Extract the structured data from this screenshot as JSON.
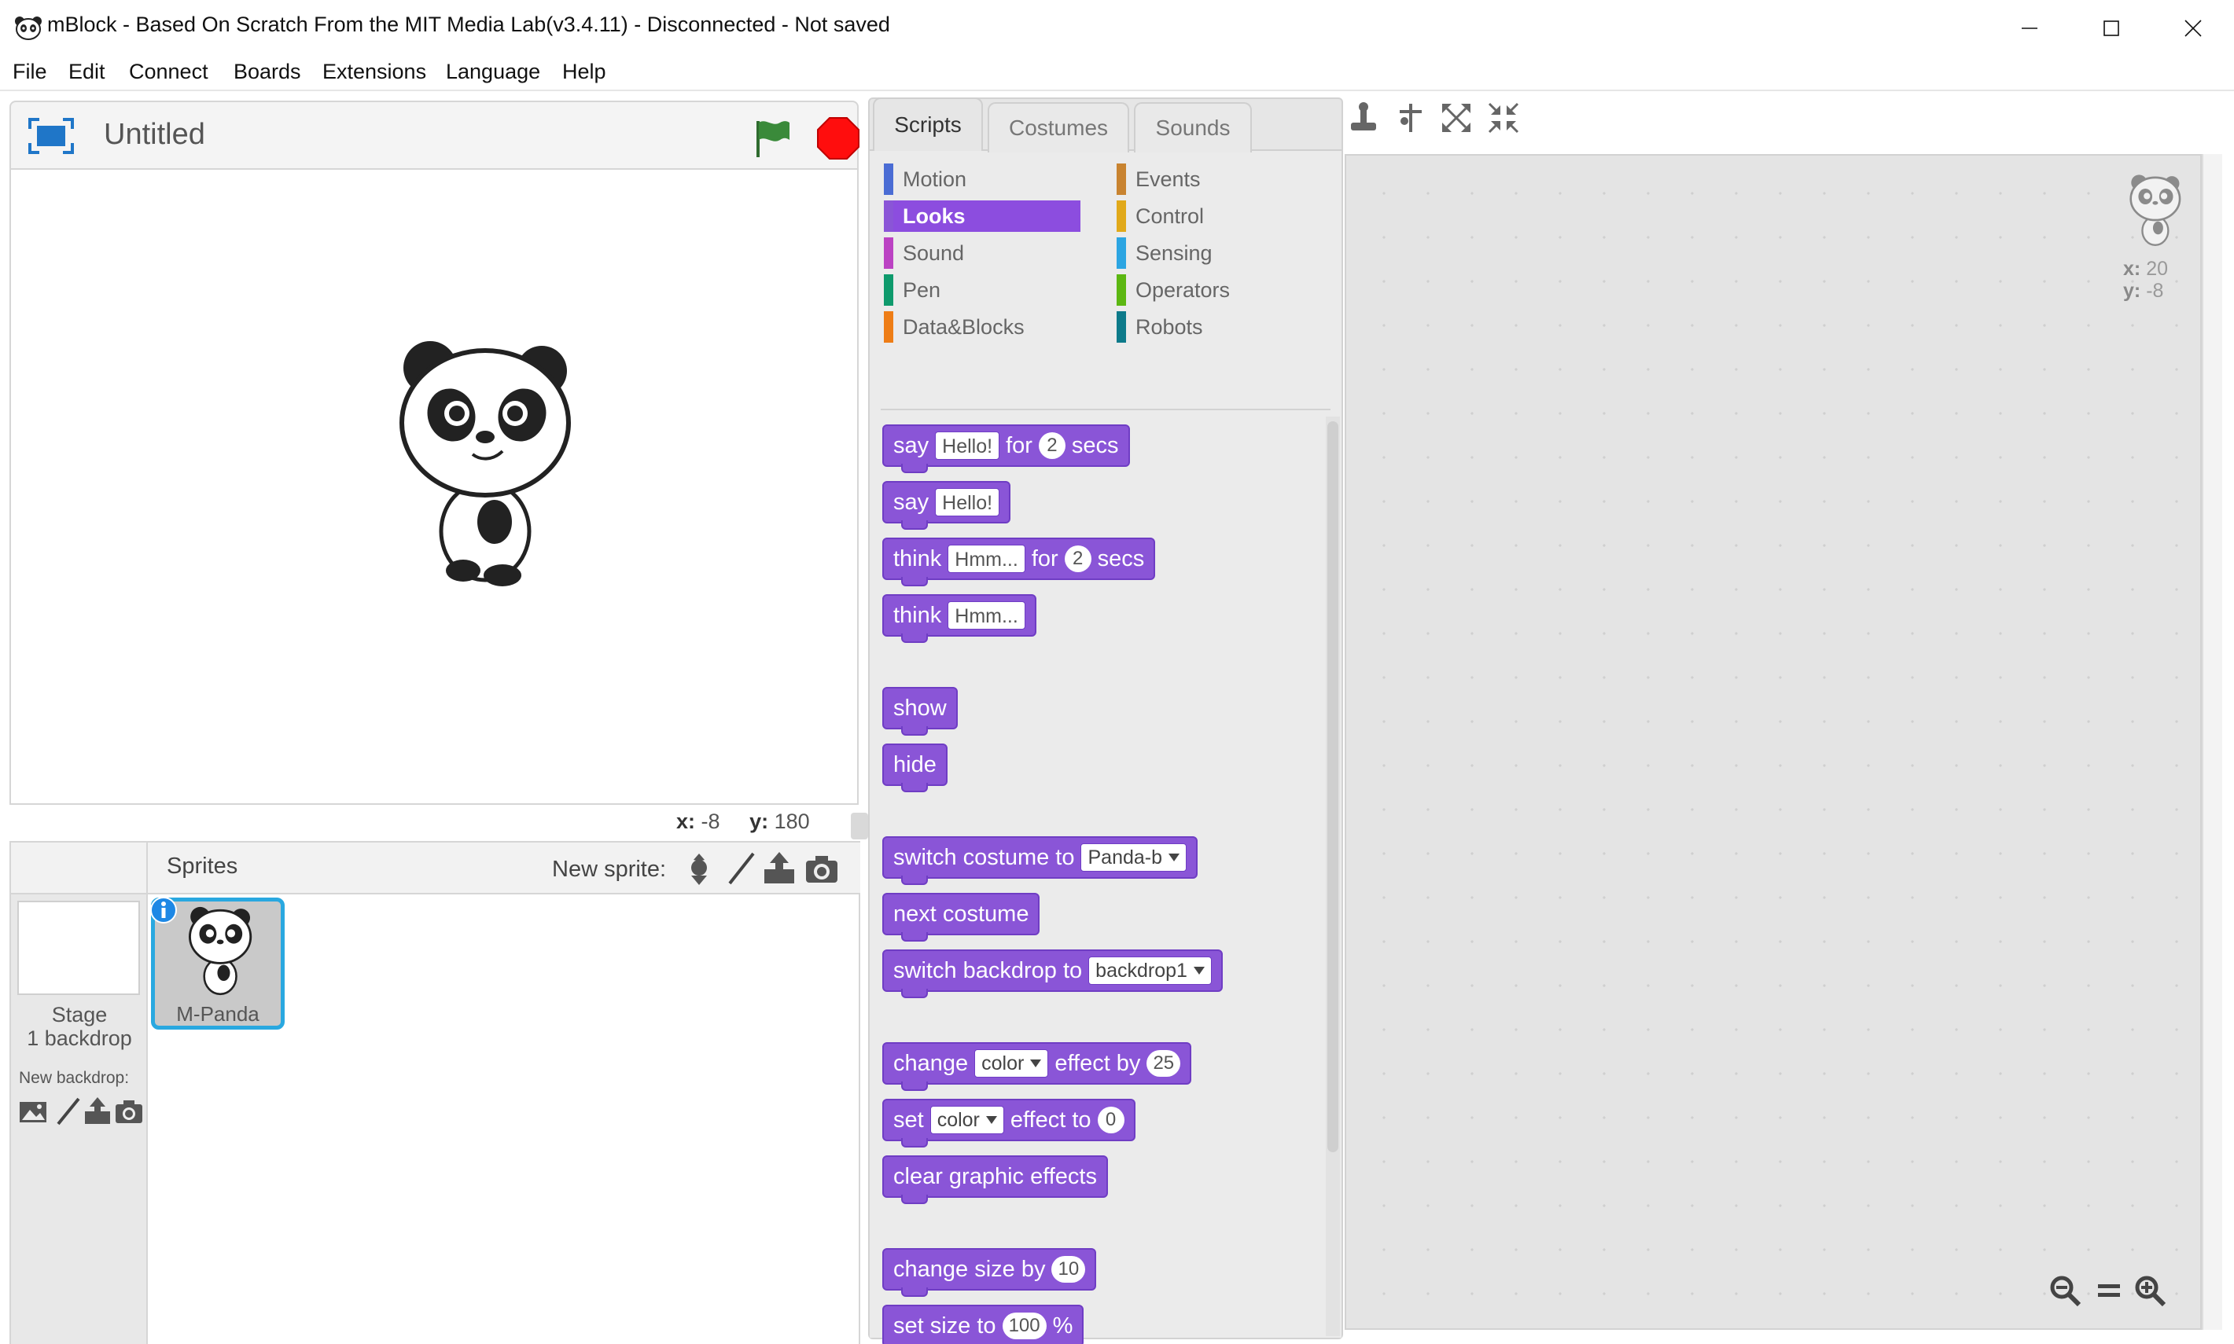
{
  "window": {
    "title": "mBlock - Based On Scratch From the MIT Media Lab(v3.4.11) - Disconnected - Not saved"
  },
  "menu": [
    "File",
    "Edit",
    "Connect",
    "Boards",
    "Extensions",
    "Language",
    "Help"
  ],
  "stage": {
    "project_title": "Untitled",
    "mouse_x_label": "x:",
    "mouse_x": "-8",
    "mouse_y_label": "y:",
    "mouse_y": "180"
  },
  "sprites_pane": {
    "title": "Sprites",
    "new_sprite_label": "New sprite:",
    "stage_label": "Stage",
    "stage_backdrops": "1 backdrop",
    "new_backdrop_label": "New backdrop:",
    "sprite_name": "M-Panda"
  },
  "tabs": [
    "Scripts",
    "Costumes",
    "Sounds"
  ],
  "categories": {
    "left": [
      {
        "label": "Motion",
        "color": "#4a6cd4"
      },
      {
        "label": "Looks",
        "color": "#8a55d7"
      },
      {
        "label": "Sound",
        "color": "#bb42c3"
      },
      {
        "label": "Pen",
        "color": "#0e9a6c"
      },
      {
        "label": "Data&Blocks",
        "color": "#ee7d16"
      }
    ],
    "right": [
      {
        "label": "Events",
        "color": "#c88330"
      },
      {
        "label": "Control",
        "color": "#e1a91a"
      },
      {
        "label": "Sensing",
        "color": "#2ca5e2"
      },
      {
        "label": "Operators",
        "color": "#5cb712"
      },
      {
        "label": "Robots",
        "color": "#0d7a8a"
      }
    ],
    "selected": "Looks"
  },
  "blocks": {
    "say_for": {
      "w1": "say",
      "arg1": "Hello!",
      "w2": "for",
      "arg2": "2",
      "w3": "secs"
    },
    "say": {
      "w1": "say",
      "arg1": "Hello!"
    },
    "think_for": {
      "w1": "think",
      "arg1": "Hmm...",
      "w2": "for",
      "arg2": "2",
      "w3": "secs"
    },
    "think": {
      "w1": "think",
      "arg1": "Hmm..."
    },
    "show": "show",
    "hide": "hide",
    "switch_costume": {
      "w1": "switch costume to",
      "arg1": "Panda-b"
    },
    "next_costume": "next costume",
    "switch_backdrop": {
      "w1": "switch backdrop to",
      "arg1": "backdrop1"
    },
    "change_effect": {
      "w1": "change",
      "arg1": "color",
      "w2": "effect by",
      "arg2": "25"
    },
    "set_effect": {
      "w1": "set",
      "arg1": "color",
      "w2": "effect to",
      "arg2": "0"
    },
    "clear_effects": "clear graphic effects",
    "change_size": {
      "w1": "change size by",
      "arg1": "10"
    },
    "set_size": {
      "w1": "set size to",
      "arg1": "100",
      "w2": "%"
    }
  },
  "script_area": {
    "x_label": "x:",
    "x": "20",
    "y_label": "y:",
    "y": "-8"
  },
  "colors": {
    "looks_block": "#8a55d7",
    "selection_border": "#29a8e0",
    "stop": "#ff0d0d",
    "flag": "#3a8a3a"
  }
}
